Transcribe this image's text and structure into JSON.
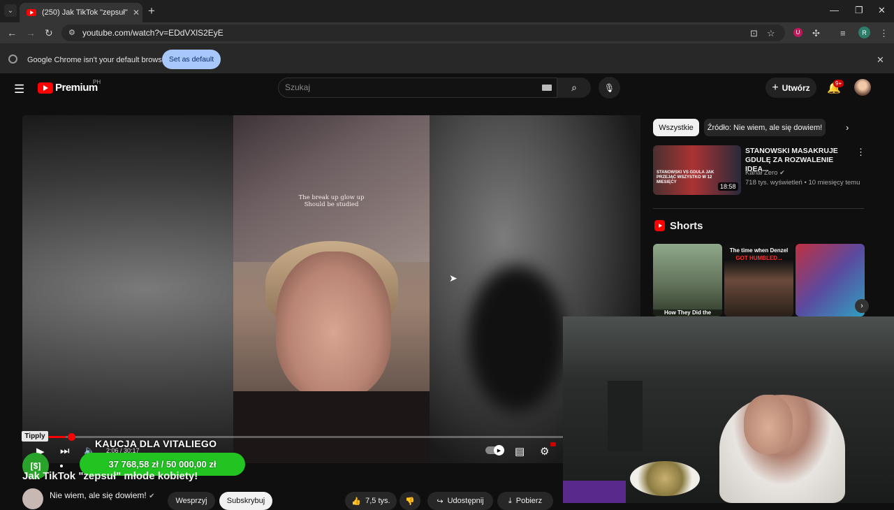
{
  "browser": {
    "tab_title": "(250) Jak TikTok \"zepsuł\" młode kobiety!",
    "url": "youtube.com/watch?v=EDdVXlS2EyE",
    "profile_letter": "R",
    "extension_letter": "U"
  },
  "infobar": {
    "message": "Google Chrome isn't your default browser",
    "button": "Set as default"
  },
  "header": {
    "logo_text": "Premium",
    "country_code": "PH",
    "search_placeholder": "Szukaj",
    "create_label": "Utwórz",
    "notification_count": "9+"
  },
  "player": {
    "overlay_line1": "The break up glow up",
    "overlay_line2": "Should be studied",
    "time": "2:06 / 30:17",
    "progress_fraction": 0.07
  },
  "donation": {
    "brand": "Tipply",
    "title": "KAUCJA DLA VITALIEGO",
    "amount": "37 768,58 zł / 50 000,00 zł",
    "raised": 37768.58,
    "goal": 50000
  },
  "video": {
    "title": "Jak TikTok \"zepsuł\" młode kobiety!",
    "channel": "Nie wiem, ale się dowiem!",
    "support_label": "Wesprzyj",
    "subscribe_label": "Subskrybuj",
    "likes": "7,5 tys.",
    "share_label": "Udostępnij",
    "download_label": "Pobierz"
  },
  "sidebar": {
    "chips": [
      "Wszystkie",
      "Źródło: Nie wiem, ale się dowiem!"
    ],
    "recommendation": {
      "title": "STANOWSKI MASAKRUJE GDULĘ ZA ROZWALENIE IDEA...",
      "channel": "Kanał Zero",
      "meta": "718 tys. wyświetleń • 10 miesięcy temu",
      "duration": "18:58",
      "thumb_text": "STANOWSKI VS GDULA JAK PRZEJĄĆ WSZYSTKO W 12 MIESIĘCY"
    },
    "shorts_label": "Shorts",
    "shorts": [
      {
        "caption": "How They Did the"
      },
      {
        "caption_top": "The time when Denzel",
        "caption_bottom": "GOT HUMBLED..."
      },
      {
        "caption": ""
      }
    ]
  },
  "colors": {
    "yt_red": "#ff0000",
    "donation_green": "#22c422",
    "set_default_button": "#a8c7fa"
  }
}
